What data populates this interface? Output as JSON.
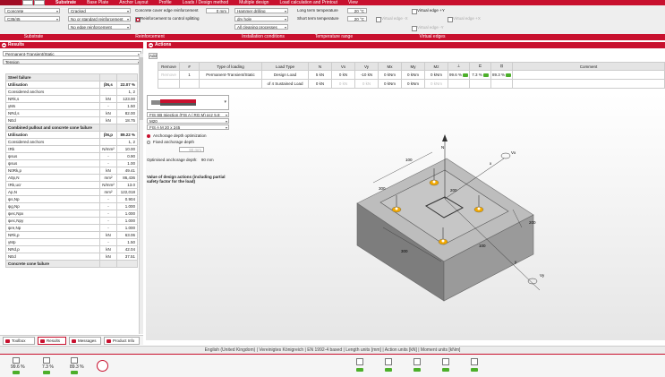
{
  "menu": {
    "items": [
      "Substrate",
      "Base Plate",
      "Anchor Layout",
      "Profile",
      "Loads / Design method",
      "Multiple design",
      "Load calculation and Printout",
      "View"
    ]
  },
  "ribbon": {
    "material": "Concrete",
    "grade": "C35/45",
    "cracked": "Cracked",
    "reinforcement": "No or standard reinforcement",
    "edge_reinforcement": "No edge reinforcement",
    "cover_label": "Concrete cover edge reinforcement",
    "cover_value": "0 mm",
    "splitting_label": "Reinforcement to control splitting",
    "drilling": "Hammer drilling",
    "hole": "dry hole",
    "cleaning": "All cleaning processes",
    "long_term_label": "Long term temperature",
    "long_term_value": "20 °C",
    "short_term_label": "Short term temperature",
    "short_term_value": "20 °C",
    "virtual_edge_y": "Virtual edge +Y",
    "virtual_edge_x_neg": "Virtual edge -X",
    "virtual_edge_x_pos": "Virtual edge +X",
    "virtual_edge_y_neg": "Virtual edge -Y",
    "groups": [
      "Substrate",
      "Reinforcement",
      "Installation conditions",
      "Temperature range",
      "Virtual edges"
    ]
  },
  "results": {
    "title": "Results",
    "load_case": "Permanent-Transient/Static",
    "mode": "Tension",
    "rows": [
      {
        "type": "hdr",
        "label": "Steel failure",
        "unit": "",
        "value": ""
      },
      {
        "type": "util",
        "label": "Utilisation",
        "unit": "βN,s",
        "value": "22.07 %"
      },
      {
        "label": "Considered anchors",
        "unit": "",
        "value": "1, 2"
      },
      {
        "label": "NRk,s",
        "unit": "kN",
        "value": "123.00"
      },
      {
        "label": "γMs",
        "unit": "-",
        "value": "1.50"
      },
      {
        "label": "NRd,s",
        "unit": "kN",
        "value": "82.00"
      },
      {
        "label": "NEd",
        "unit": "kN",
        "value": "18.75"
      },
      {
        "type": "hdr",
        "label": "Combined pullout and concrete cone failure",
        "unit": "",
        "value": ""
      },
      {
        "type": "util",
        "label": "Utilisation",
        "unit": "βN,p",
        "value": "89.22 %"
      },
      {
        "label": "Considered anchors",
        "unit": "",
        "value": "1, 2"
      },
      {
        "label": "τRk",
        "unit": "N/mm²",
        "value": "10.00"
      },
      {
        "label": "ψsus",
        "unit": "-",
        "value": "0.90"
      },
      {
        "label": "ψsus",
        "unit": "-",
        "value": "1.00"
      },
      {
        "label": "N0Rk,p",
        "unit": "kN",
        "value": "49.41"
      },
      {
        "label": "A0p,N",
        "unit": "mm²",
        "value": "86,436"
      },
      {
        "label": "τRk,ucr",
        "unit": "N/mm²",
        "value": "13.0"
      },
      {
        "label": "Ap,N",
        "unit": "mm²",
        "value": "122,018"
      },
      {
        "label": "ψs,Np",
        "unit": "-",
        "value": "0.904"
      },
      {
        "label": "ψg,Np",
        "unit": "-",
        "value": "1.000"
      },
      {
        "label": "ψec,Npx",
        "unit": "-",
        "value": "1.000"
      },
      {
        "label": "ψec,Npy",
        "unit": "-",
        "value": "1.000"
      },
      {
        "label": "ψre,Np",
        "unit": "-",
        "value": "1.000"
      },
      {
        "label": "NRk,p",
        "unit": "kN",
        "value": "63.06"
      },
      {
        "label": "γMp",
        "unit": "-",
        "value": "1.50"
      },
      {
        "label": "NRd,p",
        "unit": "kN",
        "value": "42.04"
      },
      {
        "label": "NEd",
        "unit": "kN",
        "value": "37.51"
      },
      {
        "type": "hdr",
        "label": "Concrete cone failure",
        "unit": "",
        "value": ""
      }
    ],
    "tabs": [
      "Toolbox",
      "Results",
      "Messages",
      "Product Info"
    ]
  },
  "actions": {
    "title": "Actions",
    "add_label": "Add",
    "headers": [
      "Remove",
      "#",
      "Type of loading",
      "Load Type",
      "N",
      "Vx",
      "Vy",
      "Mx",
      "My",
      "Mz",
      "",
      "",
      "",
      "Comment"
    ],
    "row1": {
      "remove": "Remove",
      "num": "1",
      "loading": "Permanent-Transient/Static",
      "load_type": "Design Load",
      "n": "5 kN",
      "vx": "0 kN",
      "vy": "-10 kN",
      "mx": "0 kNm",
      "my": "0 kNm",
      "mz": "0 kNm",
      "u1": "99.6 %",
      "u2": "7.3 %",
      "u3": "89.3 %"
    },
    "row2": {
      "load_type": "of 4 Sustained Load",
      "n": "0 kN",
      "vx": "0 kN",
      "vy": "0 kN",
      "mx": "0 kNm",
      "my": "0 kNm",
      "mz": "0 kNm"
    }
  },
  "product": {
    "system": "FIS SB Injection (FIS A / RG M) pcz 5.8",
    "size": "M20",
    "rod": "FIS A M 20 x 245",
    "opt_depth": "Anchorage depth optimization",
    "fixed_depth": "Fixed anchorage depth",
    "depth_input": "90 mm",
    "optimised_label": "Optimised anchorage depth:",
    "optimised_value": "90 mm",
    "note": "Value of design actions (including partial safety factor for the load)"
  },
  "viewport": {
    "dims": [
      "100",
      "300",
      "200",
      "300",
      "100",
      "200"
    ],
    "axis_x": "x",
    "axis_y": "y",
    "axis_n": "N",
    "axis_vx": "Vx",
    "axis_vy": "Vy"
  },
  "status": {
    "text": "English (United Kingdom) | Vereinigtes Königreich | EN 1992-4 based | Length units [mm] | Action units [kN] | Moment units [kNm]"
  },
  "bottom": {
    "u1": "99.6 %",
    "u2": "7.3 %",
    "u3": "89.3 %"
  }
}
